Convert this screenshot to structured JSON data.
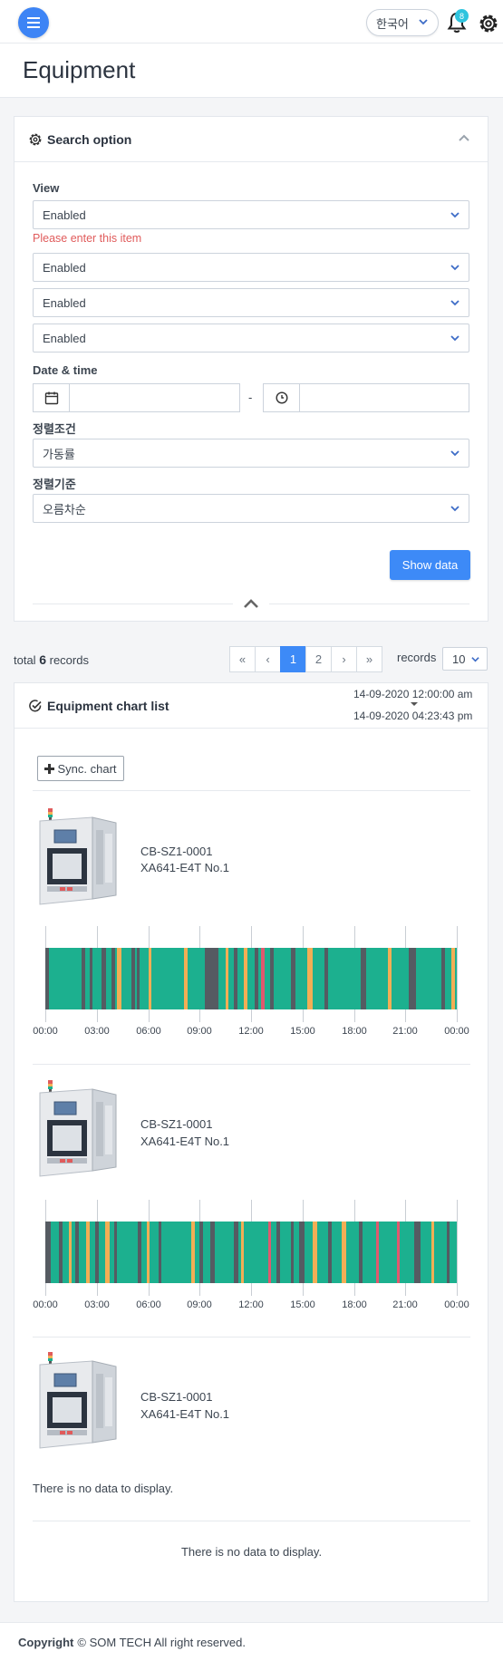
{
  "topbar": {
    "language": "한국어",
    "notification_count": "8"
  },
  "page": {
    "title": "Equipment"
  },
  "search": {
    "header": "Search option",
    "view_label": "View",
    "view_value": "Enabled",
    "error": "Please enter this item",
    "select2": "Enabled",
    "select3": "Enabled",
    "select4": "Enabled",
    "date_label": "Date & time",
    "date_from": "",
    "date_to": "",
    "date_separator": "-",
    "sort_cond_label": "정렬조건",
    "sort_cond_value": "가동률",
    "sort_order_label": "정렬기준",
    "sort_order_value": "오름차순",
    "show_button": "Show data"
  },
  "records": {
    "total_prefix": "total",
    "total_count": "6",
    "total_suffix": "records",
    "pages": [
      "«",
      "‹",
      "1",
      "2",
      "›",
      "»"
    ],
    "active_page": "1",
    "per_page_label": "records",
    "per_page_value": "10"
  },
  "chart_list": {
    "header": "Equipment chart list",
    "range_start": "14-09-2020 12:00:00 am",
    "range_end": "14-09-2020 04:23:43 pm",
    "sync_button": "Sync. chart",
    "empty_text": "There is no data to display.",
    "bottom_empty_text": "There is no data to display."
  },
  "colors": {
    "running": "#1cb08f",
    "stopped": "#555b62",
    "warning": "#f2ae55",
    "alarm": "#e0596e",
    "primary": "#3d8af7"
  },
  "chart_data": [
    {
      "type": "timeline",
      "equipment_code": "CB-SZ1-0001",
      "equipment_name": "XA641-E4T No.1",
      "x_range_hours": [
        0,
        24
      ],
      "ticks": [
        "00:00",
        "03:00",
        "06:00",
        "09:00",
        "12:00",
        "15:00",
        "18:00",
        "21:00",
        "00:00"
      ],
      "segments": [
        {
          "start": 0.0,
          "end": 0.2,
          "state": "stopped"
        },
        {
          "start": 2.1,
          "end": 2.35,
          "state": "stopped"
        },
        {
          "start": 2.6,
          "end": 2.75,
          "state": "stopped"
        },
        {
          "start": 3.3,
          "end": 3.55,
          "state": "stopped"
        },
        {
          "start": 3.85,
          "end": 4.05,
          "state": "stopped"
        },
        {
          "start": 4.2,
          "end": 4.45,
          "state": "warning"
        },
        {
          "start": 5.0,
          "end": 5.25,
          "state": "stopped"
        },
        {
          "start": 5.35,
          "end": 5.5,
          "state": "stopped"
        },
        {
          "start": 6.0,
          "end": 6.2,
          "state": "warning"
        },
        {
          "start": 8.1,
          "end": 8.3,
          "state": "warning"
        },
        {
          "start": 9.3,
          "end": 10.1,
          "state": "stopped"
        },
        {
          "start": 10.5,
          "end": 10.7,
          "state": "warning"
        },
        {
          "start": 11.0,
          "end": 11.2,
          "state": "stopped"
        },
        {
          "start": 11.6,
          "end": 11.8,
          "state": "warning"
        },
        {
          "start": 12.2,
          "end": 12.4,
          "state": "stopped"
        },
        {
          "start": 12.6,
          "end": 12.8,
          "state": "alarm"
        },
        {
          "start": 13.1,
          "end": 13.3,
          "state": "stopped"
        },
        {
          "start": 14.3,
          "end": 14.6,
          "state": "stopped"
        },
        {
          "start": 15.3,
          "end": 15.6,
          "state": "warning"
        },
        {
          "start": 16.3,
          "end": 16.5,
          "state": "stopped"
        },
        {
          "start": 18.4,
          "end": 18.7,
          "state": "stopped"
        },
        {
          "start": 20.0,
          "end": 20.2,
          "state": "warning"
        },
        {
          "start": 21.2,
          "end": 21.6,
          "state": "stopped"
        },
        {
          "start": 23.1,
          "end": 23.3,
          "state": "stopped"
        },
        {
          "start": 23.7,
          "end": 23.9,
          "state": "warning"
        }
      ]
    },
    {
      "type": "timeline",
      "equipment_code": "CB-SZ1-0001",
      "equipment_name": "XA641-E4T No.1",
      "x_range_hours": [
        0,
        24
      ],
      "ticks": [
        "00:00",
        "03:00",
        "06:00",
        "09:00",
        "12:00",
        "15:00",
        "18:00",
        "21:00",
        "00:00"
      ],
      "segments": [
        {
          "start": 0.0,
          "end": 0.3,
          "state": "stopped"
        },
        {
          "start": 0.8,
          "end": 1.0,
          "state": "stopped"
        },
        {
          "start": 1.4,
          "end": 1.55,
          "state": "warning"
        },
        {
          "start": 1.75,
          "end": 1.95,
          "state": "stopped"
        },
        {
          "start": 2.4,
          "end": 2.6,
          "state": "warning"
        },
        {
          "start": 2.9,
          "end": 3.1,
          "state": "stopped"
        },
        {
          "start": 3.5,
          "end": 3.75,
          "state": "warning"
        },
        {
          "start": 4.0,
          "end": 4.2,
          "state": "stopped"
        },
        {
          "start": 5.4,
          "end": 5.6,
          "state": "stopped"
        },
        {
          "start": 5.9,
          "end": 6.1,
          "state": "warning"
        },
        {
          "start": 6.6,
          "end": 6.75,
          "state": "stopped"
        },
        {
          "start": 8.5,
          "end": 8.7,
          "state": "warning"
        },
        {
          "start": 9.0,
          "end": 9.2,
          "state": "stopped"
        },
        {
          "start": 9.6,
          "end": 9.9,
          "state": "stopped"
        },
        {
          "start": 11.0,
          "end": 11.25,
          "state": "stopped"
        },
        {
          "start": 11.4,
          "end": 11.6,
          "state": "warning"
        },
        {
          "start": 13.0,
          "end": 13.15,
          "state": "alarm"
        },
        {
          "start": 13.5,
          "end": 13.7,
          "state": "stopped"
        },
        {
          "start": 14.3,
          "end": 14.5,
          "state": "stopped"
        },
        {
          "start": 14.8,
          "end": 15.1,
          "state": "stopped"
        },
        {
          "start": 15.6,
          "end": 15.85,
          "state": "warning"
        },
        {
          "start": 16.5,
          "end": 16.7,
          "state": "stopped"
        },
        {
          "start": 17.3,
          "end": 17.55,
          "state": "warning"
        },
        {
          "start": 18.3,
          "end": 18.5,
          "state": "stopped"
        },
        {
          "start": 19.3,
          "end": 19.45,
          "state": "alarm"
        },
        {
          "start": 20.5,
          "end": 20.65,
          "state": "alarm"
        },
        {
          "start": 21.5,
          "end": 21.9,
          "state": "stopped"
        },
        {
          "start": 22.5,
          "end": 22.7,
          "state": "warning"
        },
        {
          "start": 23.4,
          "end": 23.6,
          "state": "stopped"
        }
      ]
    },
    {
      "type": "timeline",
      "equipment_code": "CB-SZ1-0001",
      "equipment_name": "XA641-E4T No.1",
      "segments": []
    }
  ],
  "footer": {
    "copyright_bold": "Copyright",
    "copyright_text": "© SOM TECH All right reserved."
  }
}
